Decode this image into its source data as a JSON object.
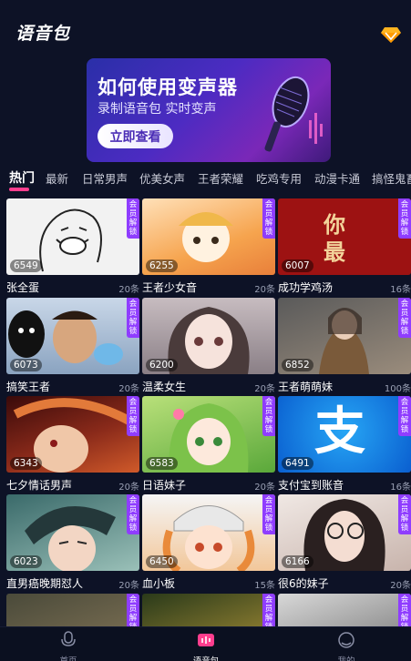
{
  "header": {
    "title": "语音包",
    "vip_icon": "diamond-icon",
    "vip_color": "#ffb41f"
  },
  "banner": {
    "title": "如何使用变声器",
    "subtitle": "录制语音包 实时变声",
    "button": "立即查看",
    "icon": "microphone-icon"
  },
  "tabs": [
    "热门",
    "最新",
    "日常男声",
    "优美女声",
    "王者荣耀",
    "吃鸡专用",
    "动漫卡通",
    "搞怪鬼畜"
  ],
  "active_tab": 0,
  "vip_tag": "会员解锁",
  "cards": [
    {
      "plays": "6549",
      "name": "张全蛋",
      "count": "20条",
      "vip": true
    },
    {
      "plays": "6255",
      "name": "王者少女音",
      "count": "20条",
      "vip": true
    },
    {
      "plays": "6007",
      "name": "成功学鸡汤",
      "count": "16条",
      "vip": true,
      "thumb_text": "你 最"
    },
    {
      "plays": "6073",
      "name": "搞笑王者",
      "count": "20条",
      "vip": true
    },
    {
      "plays": "6200",
      "name": "温柔女生",
      "count": "20条",
      "vip": false
    },
    {
      "plays": "6852",
      "name": "王者萌萌妹",
      "count": "100条",
      "vip": true
    },
    {
      "plays": "6343",
      "name": "七夕情话男声",
      "count": "20条",
      "vip": true
    },
    {
      "plays": "6583",
      "name": "日语妹子",
      "count": "20条",
      "vip": true
    },
    {
      "plays": "6491",
      "name": "支付宝到账音",
      "count": "16条",
      "vip": true,
      "thumb_text": "支"
    },
    {
      "plays": "6023",
      "name": "直男癌晚期怼人",
      "count": "20条",
      "vip": true
    },
    {
      "plays": "6450",
      "name": "血小板",
      "count": "15条",
      "vip": true
    },
    {
      "plays": "6166",
      "name": "很6的妹子",
      "count": "20条",
      "vip": true
    },
    {
      "plays": "",
      "name": "",
      "count": "",
      "vip": true
    },
    {
      "plays": "",
      "name": "",
      "count": "",
      "vip": true
    },
    {
      "plays": "",
      "name": "",
      "count": "",
      "vip": true
    }
  ],
  "bottom_nav": [
    {
      "label": "首页",
      "icon": "mic-icon"
    },
    {
      "label": "语音包",
      "icon": "audio-pack-icon"
    },
    {
      "label": "我的",
      "icon": "profile-icon"
    }
  ],
  "active_nav": 1,
  "colors": {
    "background": "#0d1226",
    "accent": "#ff3e8e",
    "vip": "#8f3dff"
  }
}
